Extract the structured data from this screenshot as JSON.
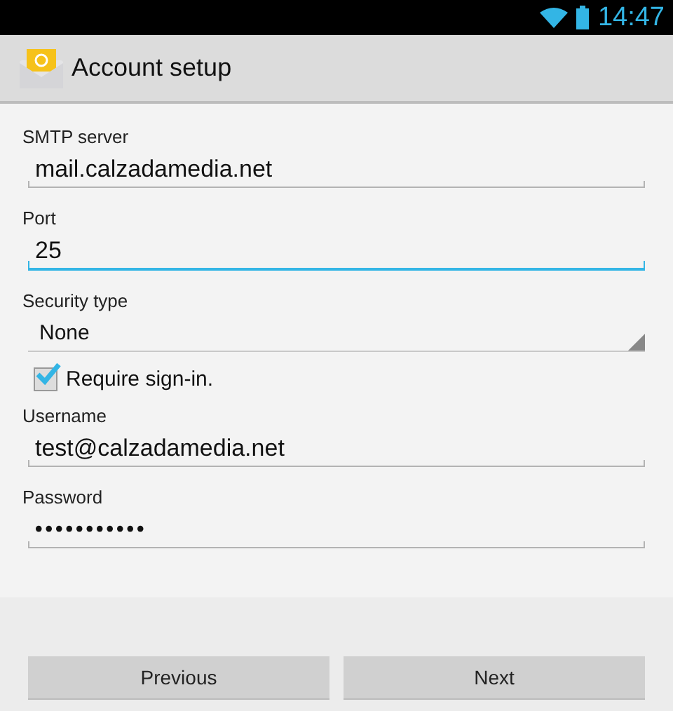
{
  "status_bar": {
    "time": "14:47"
  },
  "action_bar": {
    "title": "Account setup"
  },
  "form": [
    {
      "kind": "text",
      "label": "SMTP server",
      "value": "mail.calzadamedia.net",
      "focused": false
    },
    {
      "kind": "text",
      "label": "Port",
      "value": "25",
      "focused": true
    },
    {
      "kind": "spinner",
      "label": "Security type",
      "value": "None"
    },
    {
      "kind": "checkbox",
      "label": "Require sign-in.",
      "checked": true
    },
    {
      "kind": "text",
      "label": "Username",
      "value": "test@calzadamedia.net",
      "focused": false
    },
    {
      "kind": "password",
      "label": "Password",
      "value": "•••••••••••",
      "focused": false
    }
  ],
  "buttons": [
    "Previous",
    "Next"
  ]
}
